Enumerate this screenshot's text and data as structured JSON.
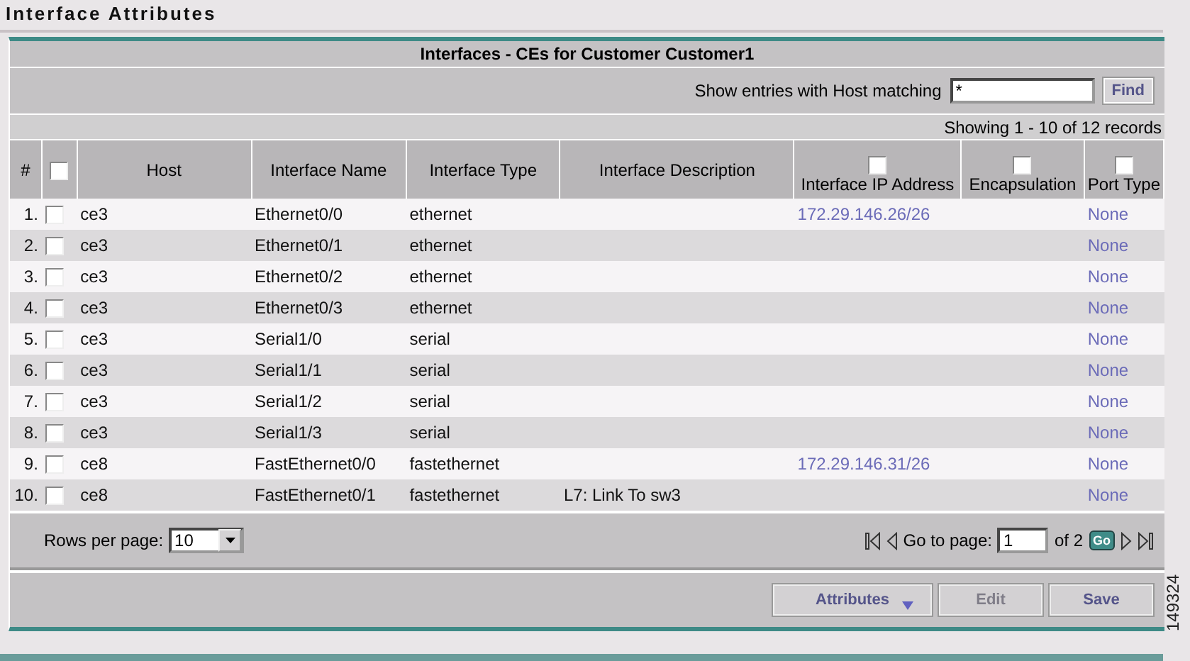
{
  "page_title": "Interface Attributes",
  "table_title": "Interfaces - CEs for Customer Customer1",
  "filter": {
    "label": "Show entries with Host matching",
    "value": "*",
    "button": "Find"
  },
  "record_count": "Showing 1 - 10 of 12 records",
  "columns": [
    {
      "label": "#",
      "kind": "plain"
    },
    {
      "kind": "select_all",
      "checked": false
    },
    {
      "label": "Host",
      "kind": "plain"
    },
    {
      "label": "Interface Name",
      "kind": "plain"
    },
    {
      "label": "Interface Type",
      "kind": "plain"
    },
    {
      "label": "Interface Description",
      "kind": "plain"
    },
    {
      "label": "Interface IP Address",
      "kind": "checkbox",
      "checked": false
    },
    {
      "label": "Encapsulation",
      "kind": "checkbox",
      "checked": false
    },
    {
      "label": "Port Type",
      "kind": "checkbox",
      "checked": false
    }
  ],
  "rows": [
    {
      "index": "1.",
      "checked": false,
      "host": "ce3",
      "name": "Ethernet0/0",
      "type": "ethernet",
      "description": "",
      "ip": "172.29.146.26/26",
      "encapsulation": "",
      "port_type": "None"
    },
    {
      "index": "2.",
      "checked": false,
      "host": "ce3",
      "name": "Ethernet0/1",
      "type": "ethernet",
      "description": "",
      "ip": "",
      "encapsulation": "",
      "port_type": "None"
    },
    {
      "index": "3.",
      "checked": false,
      "host": "ce3",
      "name": "Ethernet0/2",
      "type": "ethernet",
      "description": "",
      "ip": "",
      "encapsulation": "",
      "port_type": "None"
    },
    {
      "index": "4.",
      "checked": false,
      "host": "ce3",
      "name": "Ethernet0/3",
      "type": "ethernet",
      "description": "",
      "ip": "",
      "encapsulation": "",
      "port_type": "None"
    },
    {
      "index": "5.",
      "checked": false,
      "host": "ce3",
      "name": "Serial1/0",
      "type": "serial",
      "description": "",
      "ip": "",
      "encapsulation": "",
      "port_type": "None"
    },
    {
      "index": "6.",
      "checked": false,
      "host": "ce3",
      "name": "Serial1/1",
      "type": "serial",
      "description": "",
      "ip": "",
      "encapsulation": "",
      "port_type": "None"
    },
    {
      "index": "7.",
      "checked": false,
      "host": "ce3",
      "name": "Serial1/2",
      "type": "serial",
      "description": "",
      "ip": "",
      "encapsulation": "",
      "port_type": "None"
    },
    {
      "index": "8.",
      "checked": false,
      "host": "ce3",
      "name": "Serial1/3",
      "type": "serial",
      "description": "",
      "ip": "",
      "encapsulation": "",
      "port_type": "None"
    },
    {
      "index": "9.",
      "checked": false,
      "host": "ce8",
      "name": "FastEthernet0/0",
      "type": "fastethernet",
      "description": "",
      "ip": "172.29.146.31/26",
      "encapsulation": "",
      "port_type": "None"
    },
    {
      "index": "10.",
      "checked": false,
      "host": "ce8",
      "name": "FastEthernet0/1",
      "type": "fastethernet",
      "description": "L7: Link To sw3",
      "ip": "",
      "encapsulation": "",
      "port_type": "None"
    }
  ],
  "pagination": {
    "rows_label": "Rows per page:",
    "rows_value": "10",
    "goto_label": "Go to page:",
    "page_value": "1",
    "of_label": "of 2",
    "go_button": "Go"
  },
  "buttons": [
    {
      "label": "Attributes",
      "kind": "menu",
      "disabled": false
    },
    {
      "label": "Edit",
      "kind": "plain",
      "disabled": true
    },
    {
      "label": "Save",
      "kind": "plain",
      "disabled": false
    }
  ],
  "figure_number": "149324"
}
